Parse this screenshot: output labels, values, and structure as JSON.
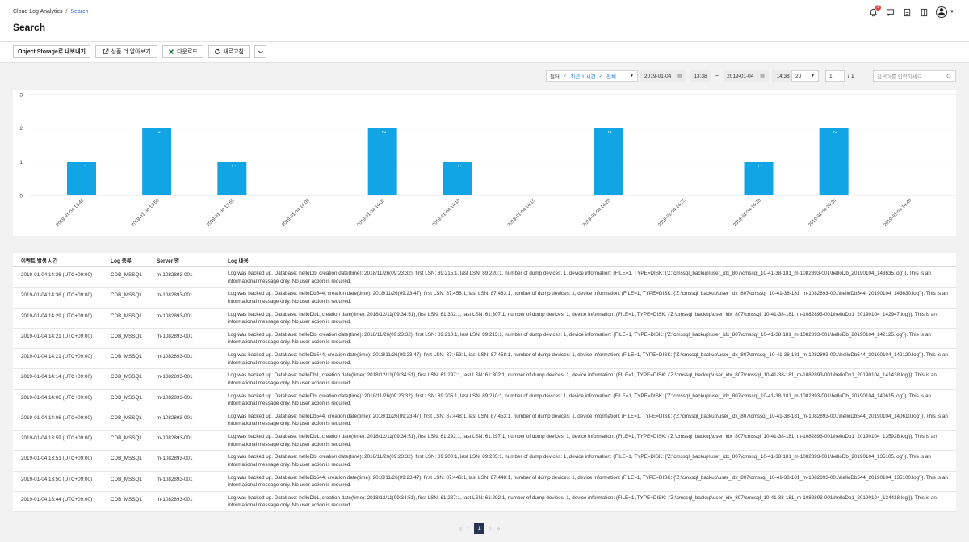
{
  "breadcrumb": {
    "root": "Cloud Log Analytics",
    "separator": "/",
    "current": "Search"
  },
  "page_title": "Search",
  "header_icons": {
    "notification_count": "2",
    "icons": [
      "bell-icon",
      "chat-icon",
      "document-icon",
      "manual-icon",
      "user-avatar-icon"
    ]
  },
  "toolbar": {
    "export_label": "Object Storage로 내보내기",
    "learn_more_label": "상품 더 알아보기",
    "download_label": "다운로드",
    "refresh_label": "새로고침",
    "more_icon": "chevron-down-icon"
  },
  "filter": {
    "filter_label": "필터",
    "time_chip": "최근 1 시간",
    "all_chip": "전체",
    "start_date": "2019-01-04",
    "start_time": "13:38",
    "range_sep": "~",
    "end_date": "2019-01-04",
    "end_time": "14:38",
    "page_size": "20",
    "page_input": "1",
    "page_total": "/ 1",
    "search_placeholder": "검색어를 입력하세요"
  },
  "colors": {
    "bar": "#12a5e6",
    "accent": "#2f86d6",
    "pager_active": "#293453"
  },
  "chart_data": {
    "type": "bar",
    "categories": [
      "2019-01-04 13:45",
      "2019-01-04 13:50",
      "2019-01-04 13:55",
      "2019-01-04 14:00",
      "2019-01-04 14:05",
      "2019-01-04 14:10",
      "2019-01-04 14:15",
      "2019-01-04 14:20",
      "2019-01-04 14:25",
      "2019-01-04 14:30",
      "2019-01-04 14:35",
      "2019-01-04 14:40"
    ],
    "values": [
      1,
      2,
      1,
      0,
      2,
      1,
      0,
      2,
      0,
      1,
      2,
      0
    ],
    "ylim": [
      0,
      3
    ],
    "yticks": [
      "0",
      "1",
      "2",
      "3"
    ],
    "grid": true,
    "title": "",
    "xlabel": "",
    "ylabel": ""
  },
  "table": {
    "headers": [
      "이벤트 발생 시간",
      "Log 종류",
      "Server 명",
      "Log 내용"
    ],
    "rows": [
      [
        "2019-01-04 14:36 (UTC+09:00)",
        "CDB_MSSQL",
        "m-1082893-001",
        "Log was backed up. Database: helloDb, creation date(time): 2018/11/26(09:23:32), first LSN: 89:215:1, last LSN: 89:220:1, number of dump devices: 1, device information: (FILE=1, TYPE=DISK: {'Z:\\cmssql_backup\\user_idx_807\\cmssql_10-41-38-181_m-1082893-001\\helloDb_20190104_143635.log'}). This is an informational message only. No user action is required."
      ],
      [
        "2019-01-04 14:36 (UTC+09:00)",
        "CDB_MSSQL",
        "m-1082893-001",
        "Log was backed up. Database: helloDb544, creation date(time): 2018/11/26(09:23:47), first LSN: 87:458:1, last LSN: 87:463:1, number of dump devices: 1, device information: (FILE=1, TYPE=DISK: {'Z:\\cmssql_backup\\user_idx_807\\cmssql_10-41-38-181_m-1082893-001\\helloDb544_20190104_143630.log'}). This is an informational message only. No user action is required."
      ],
      [
        "2019-01-04 14:29 (UTC+09:00)",
        "CDB_MSSQL",
        "m-1082893-001",
        "Log was backed up. Database: helloDb1, creation date(time): 2018/12/11(09:34:51), first LSN: 61:302:1, last LSN: 61:307:1, number of dump devices: 1, device information: (FILE=1, TYPE=DISK: {'Z:\\cmssql_backup\\user_idx_807\\cmssql_10-41-38-181_m-1082893-001\\helloDb1_20190104_142947.log'}). This is an informational message only. No user action is required."
      ],
      [
        "2019-01-04 14:21 (UTC+09:00)",
        "CDB_MSSQL",
        "m-1082893-001",
        "Log was backed up. Database: helloDb, creation date(time): 2018/11/26(09:23:32), first LSN: 89:210:1, last LSN: 89:215:1, number of dump devices: 1, device information: (FILE=1, TYPE=DISK: {'Z:\\cmssql_backup\\user_idx_807\\cmssql_10-41-38-181_m-1082893-001\\helloDb_20190104_142125.log'}). This is an informational message only. No user action is required."
      ],
      [
        "2019-01-04 14:21 (UTC+09:00)",
        "CDB_MSSQL",
        "m-1082893-001",
        "Log was backed up. Database: helloDb544, creation date(time): 2018/11/26(09:23:47), first LSN: 87:453:1, last LSN: 87:458:1, number of dump devices: 1, device information: (FILE=1, TYPE=DISK: {'Z:\\cmssql_backup\\user_idx_807\\cmssql_10-41-38-181_m-1082893-001\\helloDb544_20190104_142120.log'}). This is an informational message only. No user action is required."
      ],
      [
        "2019-01-04 14:14 (UTC+09:00)",
        "CDB_MSSQL",
        "m-1082893-001",
        "Log was backed up. Database: helloDb1, creation date(time): 2018/12/11(09:34:51), first LSN: 61:297:1, last LSN: 61:302:1, number of dump devices: 1, device information: (FILE=1, TYPE=DISK: {'Z:\\cmssql_backup\\user_idx_807\\cmssql_10-41-38-181_m-1082893-001\\helloDb1_20190104_141438.log'}). This is an informational message only. No user action is required."
      ],
      [
        "2019-01-04 14:06 (UTC+09:00)",
        "CDB_MSSQL",
        "m-1082893-001",
        "Log was backed up. Database: helloDb, creation date(time): 2018/11/26(09:23:32), first LSN: 89:205:1, last LSN: 89:210:1, number of dump devices: 1, device information: (FILE=1, TYPE=DISK: {'Z:\\cmssql_backup\\user_idx_807\\cmssql_10-41-38-181_m-1082893-001\\helloDb_20190104_140615.log'}). This is an informational message only. No user action is required."
      ],
      [
        "2019-01-04 14:06 (UTC+09:00)",
        "CDB_MSSQL",
        "m-1082893-001",
        "Log was backed up. Database: helloDb544, creation date(time): 2018/11/26(09:23:47), first LSN: 87:448:1, last LSN: 87:453:1, number of dump devices: 1, device information: (FILE=1, TYPE=DISK: {'Z:\\cmssql_backup\\user_idx_807\\cmssql_10-41-38-181_m-1082893-001\\helloDb544_20190104_140610.log'}). This is an informational message only. No user action is required."
      ],
      [
        "2019-01-04 13:59 (UTC+09:00)",
        "CDB_MSSQL",
        "m-1082893-001",
        "Log was backed up. Database: helloDb1, creation date(time): 2018/12/11(09:34:51), first LSN: 61:292:1, last LSN: 61:297:1, number of dump devices: 1, device information: (FILE=1, TYPE=DISK: {'Z:\\cmssql_backup\\user_idx_807\\cmssql_10-41-38-181_m-1082893-001\\helloDb1_20190104_135928.log'}). This is an informational message only. No user action is required."
      ],
      [
        "2019-01-04 13:51 (UTC+09:00)",
        "CDB_MSSQL",
        "m-1082893-001",
        "Log was backed up. Database: helloDb, creation date(time): 2018/11/26(09:23:32), first LSN: 89:200:1, last LSN: 89:205:1, number of dump devices: 1, device information: (FILE=1, TYPE=DISK: {'Z:\\cmssql_backup\\user_idx_807\\cmssql_10-41-38-181_m-1082893-001\\helloDb_20190104_135105.log'}). This is an informational message only. No user action is required."
      ],
      [
        "2019-01-04 13:50 (UTC+09:00)",
        "CDB_MSSQL",
        "m-1082893-001",
        "Log was backed up. Database: helloDb544, creation date(time): 2018/11/26(09:23:47), first LSN: 87:443:1, last LSN: 87:448:1, number of dump devices: 1, device information: (FILE=1, TYPE=DISK: {'Z:\\cmssql_backup\\user_idx_807\\cmssql_10-41-38-181_m-1082893-001\\helloDb544_20190104_135100.log'}). This is an informational message only. No user action is required."
      ],
      [
        "2019-01-04 13:44 (UTC+09:00)",
        "CDB_MSSQL",
        "m-1082893-001",
        "Log was backed up. Database: helloDb1, creation date(time): 2018/12/11(09:34:51), first LSN: 61:287:1, last LSN: 61:292:1, number of dump devices: 1, device information: (FILE=1, TYPE=DISK: {'Z:\\cmssql_backup\\user_idx_807\\cmssql_10-41-38-181_m-1082893-001\\helloDb1_20190104_134418.log'}). This is an informational message only. No user action is required."
      ]
    ]
  },
  "pagination": {
    "first": "«",
    "prev": "‹",
    "current": "1",
    "next": "›",
    "last": "»"
  }
}
